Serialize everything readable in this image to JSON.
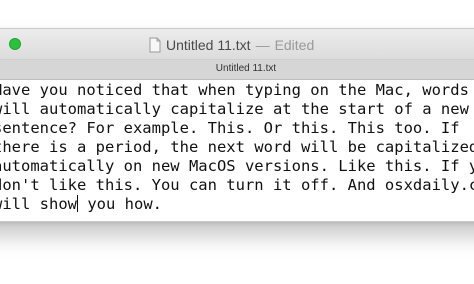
{
  "window": {
    "title": "Untitled 11.txt",
    "title_separator": "—",
    "status": "Edited",
    "tab_label": "Untitled 11.txt"
  },
  "document": {
    "lines": [
      "Have you noticed that when typing on the Mac, words",
      "will automatically capitalize at the start of a new",
      "sentence? For example. This. Or this. This too. If",
      "there is a period, the next word will be capitalized",
      "automatically on new MacOS versions. Like this. If you",
      "don't like this. You can turn it off. And osxdaily.com",
      "will show"
    ],
    "last_line_after_caret": " you how."
  },
  "icons": {
    "close_button": "green-zoom-button",
    "document": "document-icon"
  },
  "colors": {
    "zoom_button": "#2bc13f",
    "titlebar": "#e4e4e4",
    "tabbar": "#d6d6d6"
  }
}
